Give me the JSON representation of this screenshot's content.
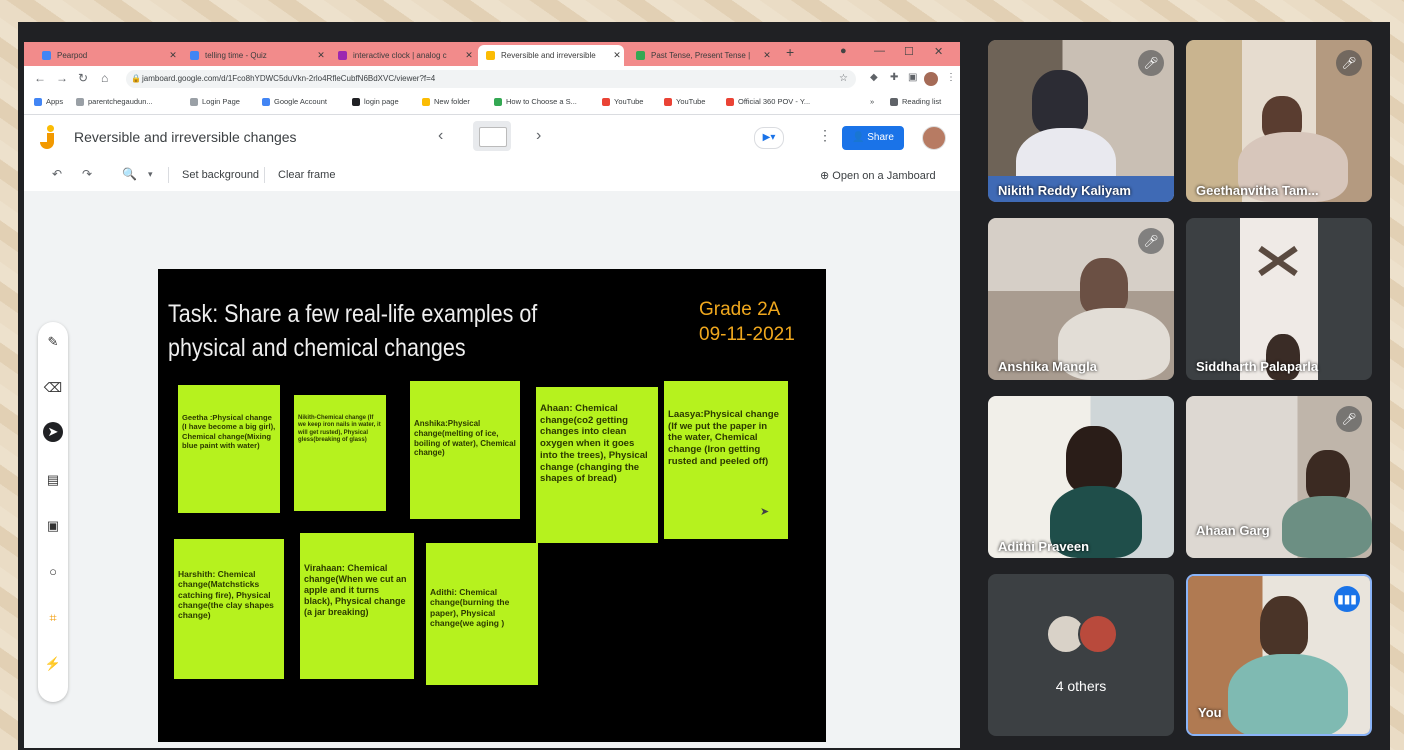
{
  "browser": {
    "tabs": [
      {
        "label": "Pearpod",
        "favicon_color": "#4285f4"
      },
      {
        "label": "telling time - Quiz",
        "favicon_color": "#4285f4"
      },
      {
        "label": "interactive clock | analog c",
        "favicon_color": "#9c27b0"
      },
      {
        "label": "Reversible and irreversible",
        "favicon_color": "#fbbc04"
      },
      {
        "label": "Past Tense, Present Tense |",
        "favicon_color": "#34a853"
      }
    ],
    "new_tab": "+",
    "url": "jamboard.google.com/d/1Fco8hYDWC5duVkn-2rlo4RfleCubfN6BdXVC/viewer?f=4",
    "bookmarks": [
      {
        "label": "Apps",
        "color": "#4285f4"
      },
      {
        "label": "parentchegaudun...",
        "color": "#5f6368"
      },
      {
        "label": "Login Page",
        "color": "#5f6368"
      },
      {
        "label": "Google Account",
        "color": "#4285f4"
      },
      {
        "label": "login page",
        "color": "#202124"
      },
      {
        "label": "New folder",
        "color": "#fbbc04"
      },
      {
        "label": "How to Choose a S...",
        "color": "#34a853"
      },
      {
        "label": "YouTube",
        "color": "#ea4335"
      },
      {
        "label": "YouTube",
        "color": "#ea4335"
      },
      {
        "label": "Official 360 POV - Y...",
        "color": "#ea4335"
      },
      {
        "label": "Reading list",
        "color": "#5f6368"
      }
    ]
  },
  "jamboard": {
    "title": "Reversible and irreversible changes",
    "share_label": "Share",
    "toolbar": {
      "set_background": "Set background",
      "clear_frame": "Clear frame",
      "open_jamboard": "Open on a Jamboard"
    },
    "frame": {
      "title": "Task: Share a few real-life examples of physical and chemical changes",
      "grade": "Grade 2A",
      "date": "09-11-2021",
      "notes": [
        "Geetha :Physical change (I have become a big girl), Chemical change(Mixing blue paint with water)",
        "Nikith-Chemical change (If we keep iron nails in water, it will get rusted), Physical gless(breaking of glass)",
        "Anshika:Physical change(melting of ice, boiling of water), Chemical change)",
        "Ahaan: Chemical change(co2 getting changes into clean oxygen when it goes into the trees), Physical change (changing the shapes of bread)",
        "Laasya:Physical change (If we put the paper in the water, Chemical change (Iron getting rusted and peeled off)",
        "Harshith: Chemical change(Matchsticks catching fire), Physical change(the clay shapes change)",
        "Virahaan: Chemical change(When we cut an apple and it turns black), Physical change (a jar breaking)",
        "Adithi: Chemical change(burning the paper), Physical change(we aging )"
      ]
    }
  },
  "meet": {
    "participants": [
      {
        "name": "Nikith Reddy Kaliyam",
        "muted": true
      },
      {
        "name": "Geethanvitha Tam...",
        "muted": true
      },
      {
        "name": "Anshika Mangla",
        "muted": true
      },
      {
        "name": "Siddharth Palaparla",
        "muted": false
      },
      {
        "name": "Adithi Praveen",
        "muted": false
      },
      {
        "name": "Ahaan Garg",
        "muted": true
      }
    ],
    "others_label": "4 others",
    "self_label": "You"
  }
}
